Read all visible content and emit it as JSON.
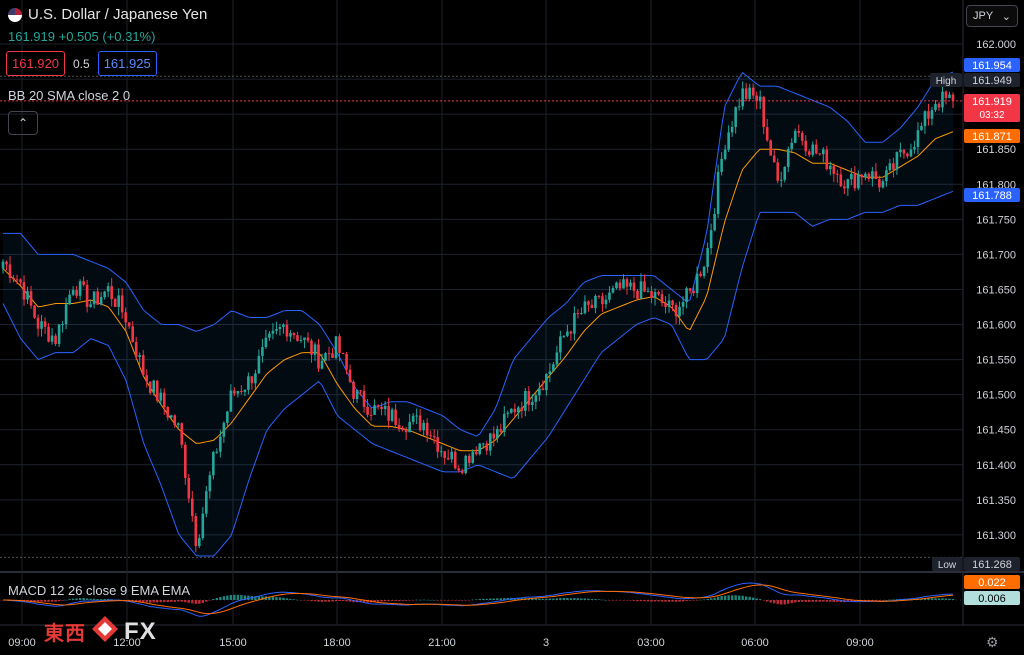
{
  "header": {
    "title": "U.S. Dollar / Japanese Yen",
    "price_line": "161.919  +0.505 (+0.31%)",
    "bid": "161.920",
    "spread": "0.5",
    "ask": "161.925",
    "currency": "JPY"
  },
  "indicators": {
    "bb_label": "BB 20 SMA close 2 0",
    "macd_label": "MACD 12 26 close 9 EMA EMA"
  },
  "logo": {
    "cn": "東西",
    "fx": "FX"
  },
  "colors": {
    "up": "#26a69a",
    "down": "#f23645",
    "bb": "#2962ff",
    "basis": "#ff9800",
    "bg": "#000000"
  },
  "chart_data": {
    "type": "candlestick",
    "ylim": [
      161.25,
      162.02
    ],
    "y_ticks": [
      "162.000",
      "161.950",
      "161.900",
      "161.850",
      "161.800",
      "161.750",
      "161.700",
      "161.650",
      "161.600",
      "161.550",
      "161.500",
      "161.450",
      "161.400",
      "161.350",
      "161.300"
    ],
    "x_ticks": [
      "09:00",
      "12:00",
      "15:00",
      "18:00",
      "21:00",
      "3",
      "03:00",
      "06:00",
      "09:00"
    ],
    "anchors": [
      161.69,
      161.66,
      161.6,
      161.58,
      161.66,
      161.63,
      161.65,
      161.61,
      161.53,
      161.49,
      161.45,
      161.29,
      161.41,
      161.5,
      161.52,
      161.57,
      161.6,
      161.58,
      161.55,
      161.57,
      161.5,
      161.48,
      161.47,
      161.46,
      161.46,
      161.42,
      161.4,
      161.43,
      161.44,
      161.48,
      161.5,
      161.53,
      161.59,
      161.62,
      161.63,
      161.65,
      161.65,
      161.64,
      161.62,
      161.64,
      161.7,
      161.86,
      161.93,
      161.92,
      161.8,
      161.88,
      161.85,
      161.83,
      161.8,
      161.82,
      161.8,
      161.84,
      161.87,
      161.92,
      161.919
    ],
    "bb_upper": [
      161.73,
      161.73,
      161.7,
      161.7,
      161.7,
      161.69,
      161.68,
      161.66,
      161.62,
      161.6,
      161.6,
      161.59,
      161.6,
      161.62,
      161.61,
      161.61,
      161.62,
      161.62,
      161.6,
      161.56,
      161.51,
      161.48,
      161.49,
      161.49,
      161.48,
      161.47,
      161.45,
      161.44,
      161.48,
      161.55,
      161.58,
      161.61,
      161.63,
      161.66,
      161.67,
      161.67,
      161.67,
      161.67,
      161.65,
      161.63,
      161.73,
      161.91,
      161.96,
      161.94,
      161.94,
      161.93,
      161.92,
      161.91,
      161.89,
      161.86,
      161.86,
      161.88,
      161.91,
      161.95,
      161.96
    ],
    "bb_lower": [
      161.63,
      161.58,
      161.55,
      161.56,
      161.56,
      161.58,
      161.57,
      161.52,
      161.43,
      161.37,
      161.3,
      161.27,
      161.27,
      161.3,
      161.38,
      161.45,
      161.48,
      161.5,
      161.52,
      161.47,
      161.45,
      161.43,
      161.42,
      161.41,
      161.4,
      161.39,
      161.39,
      161.4,
      161.39,
      161.38,
      161.41,
      161.44,
      161.48,
      161.52,
      161.56,
      161.58,
      161.6,
      161.61,
      161.6,
      161.55,
      161.55,
      161.58,
      161.68,
      161.76,
      161.76,
      161.76,
      161.74,
      161.75,
      161.75,
      161.76,
      161.76,
      161.77,
      161.77,
      161.78,
      161.79
    ],
    "price_labels": {
      "high_value": "161.954",
      "high_close": "161.949",
      "high_label": "High",
      "current": "161.919",
      "countdown": "03:32",
      "bb_basis": "161.871",
      "bb_lower": "161.788",
      "low_value": "161.268",
      "low_label": "Low"
    },
    "macd": {
      "macd_value": "0.022",
      "signal_value": "0.006"
    }
  }
}
